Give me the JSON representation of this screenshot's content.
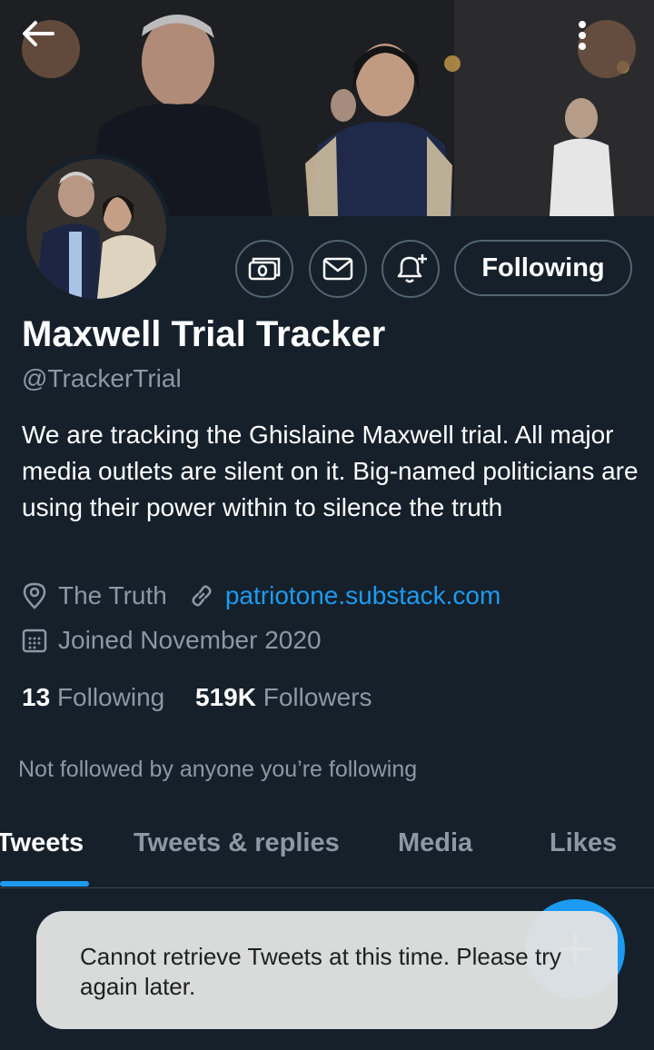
{
  "profile": {
    "name": "Maxwell Trial Tracker",
    "handle": "@TrackerTrial",
    "bio": "We are tracking the Ghislaine Maxwell trial. All major media outlets are silent on it. Big-named politicians are using their power within to silence the truth",
    "location": "The Truth",
    "website": "patriotone.substack.com",
    "joined": "Joined November 2020",
    "following_count": "13",
    "following_label": "Following",
    "followers_count": "519K",
    "followers_label": "Followers",
    "not_followed_note": "Not followed by anyone you’re following"
  },
  "actions": {
    "follow_state_label": "Following",
    "tip_icon": "tip-jar-icon",
    "message_icon": "mail-icon",
    "notify_icon": "bell-plus-icon"
  },
  "tabs": [
    {
      "label": "Tweets",
      "active": true
    },
    {
      "label": "Tweets & replies",
      "active": false
    },
    {
      "label": "Media",
      "active": false
    },
    {
      "label": "Likes",
      "active": false
    }
  ],
  "toast": {
    "message": "Cannot retrieve Tweets at this time. Please try again later."
  },
  "colors": {
    "background": "#15202b",
    "accent": "#1d9bf0",
    "muted_text": "#8b98a5",
    "border": "#536471"
  }
}
